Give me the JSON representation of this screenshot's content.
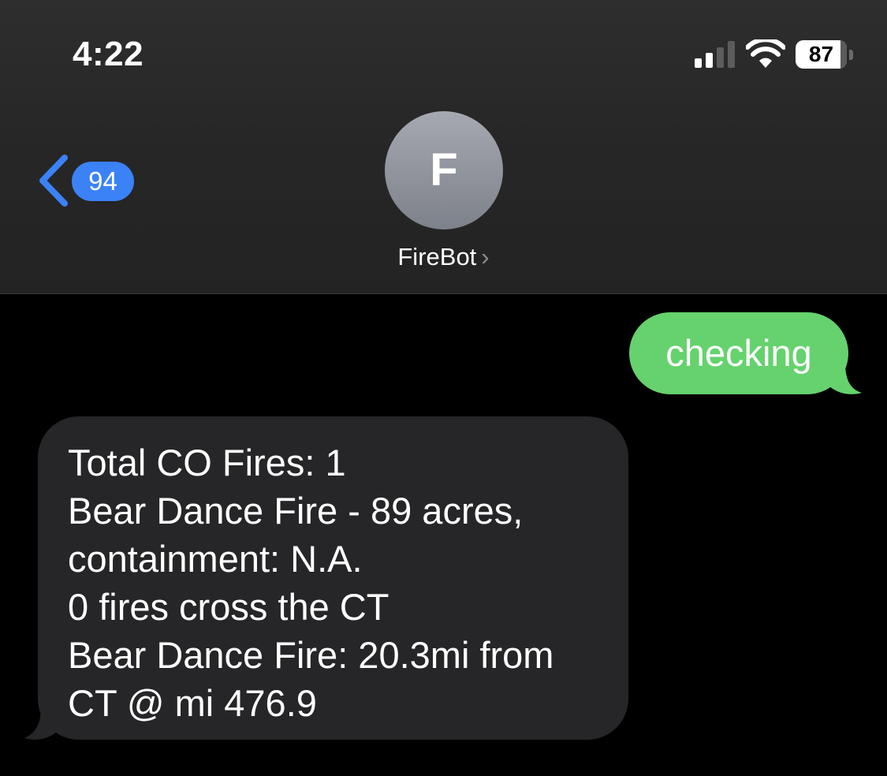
{
  "status_bar": {
    "time": "4:22",
    "battery_percent": "87",
    "battery_level": 0.87,
    "signal_bars_active": 2,
    "signal_bars_total": 4
  },
  "nav": {
    "back_badge": "94",
    "avatar_initial": "F",
    "contact_name": "FireBot",
    "contact_chevron": "›"
  },
  "messages": [
    {
      "direction": "sent",
      "lines": [
        "checking"
      ]
    },
    {
      "direction": "received",
      "lines": [
        "Total CO Fires: 1",
        "Bear Dance Fire - 89 acres,",
        "containment: N.A.",
        "0 fires cross the CT",
        "Bear Dance Fire: 20.3mi from",
        "CT @ mi 476.9"
      ]
    }
  ],
  "colors": {
    "sent_bubble": "#65d26e",
    "received_bubble": "#262628",
    "accent_blue": "#3b82f6",
    "background": "#000000"
  },
  "icons": {
    "signal": "cellular-signal-icon",
    "wifi": "wifi-icon",
    "battery": "battery-icon",
    "back": "chevron-left-icon",
    "contact_more": "chevron-right-icon"
  }
}
